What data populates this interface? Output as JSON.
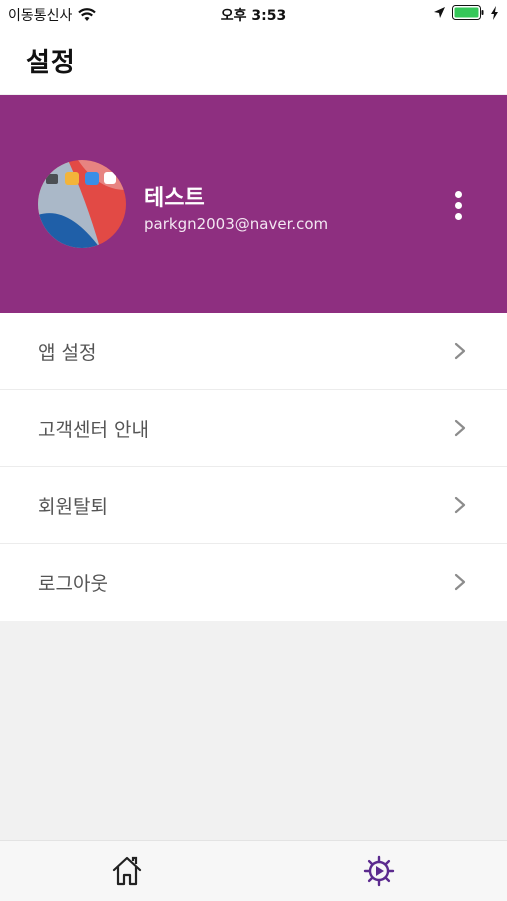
{
  "status_bar": {
    "carrier": "이동통신사",
    "time": "오후 3:53",
    "icons": [
      "wifi-icon",
      "location-icon",
      "battery-icon",
      "charging-icon"
    ]
  },
  "header": {
    "title": "설정"
  },
  "profile": {
    "name": "테스트",
    "email": "parkgn2003@naver.com",
    "background_color": "#8e2f80"
  },
  "menu": {
    "items": [
      {
        "label": "앱 설정"
      },
      {
        "label": "고객센터 안내"
      },
      {
        "label": "회원탈퇴"
      },
      {
        "label": "로그아웃"
      }
    ]
  },
  "tab_bar": {
    "tabs": [
      {
        "icon": "home-icon",
        "active": false
      },
      {
        "icon": "settings-gear-icon",
        "active": true
      }
    ],
    "active_color": "#5b2a8e"
  }
}
